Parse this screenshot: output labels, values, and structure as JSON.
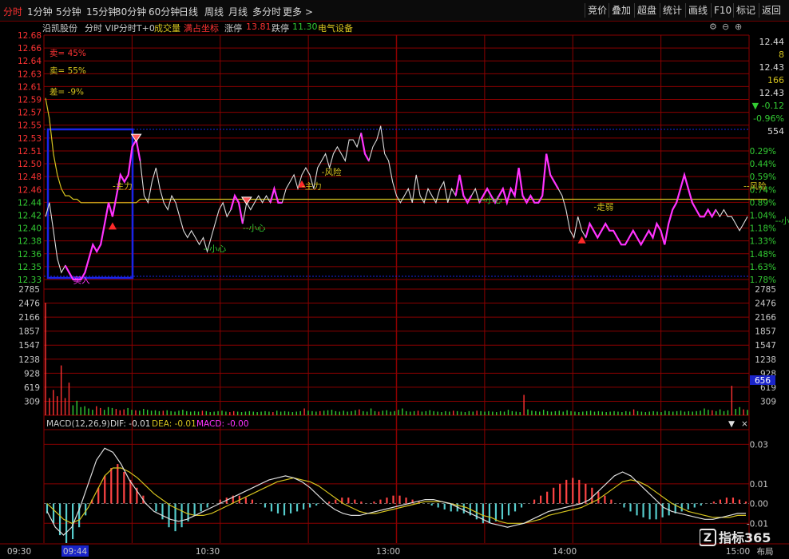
{
  "toolbar": {
    "tabs": [
      "分时",
      "1分钟",
      "5分钟",
      "15分钟",
      "30分钟",
      "60分钟",
      "日线",
      "周线",
      "月线",
      "多分时",
      "更多 >"
    ],
    "active_tab": "分时",
    "right_buttons": [
      "竞价",
      "叠加",
      "超盘",
      "统计",
      "画线",
      "F10",
      "标记",
      "返回"
    ]
  },
  "infobar": {
    "stock_name": "沿凯股份",
    "mode": "分时 VIP分时T+0",
    "volume_label": "成交量",
    "full_coord": "满占坐标",
    "limit_up_label": "涨停",
    "limit_up_value": "13.81",
    "limit_down_label": "跌停",
    "limit_down_value": "11.30",
    "sector": "电气设备"
  },
  "right_panel": {
    "price1": "12.44",
    "vol1": "8",
    "price2": "12.43",
    "vol2": "166",
    "price3": "12.43",
    "change": "▼ -0.12",
    "change_pct": "-0.96%",
    "vol3": "554",
    "vol_box": "656"
  },
  "colors": {
    "up": "#ff3333",
    "down": "#33cc33",
    "price_line": "#dddddd",
    "avg_line": "#d4c21e",
    "magenta": "#ff33ff",
    "box": "#1a24e8",
    "grid": "#8a0000",
    "macd_dea": "#d4c21e",
    "macd_dif": "#dddddd",
    "macd_up": "#ff4444",
    "macd_down": "#55cccc"
  },
  "chart_data": [
    {
      "type": "line",
      "panel": "price",
      "y_ticks_left": [
        "12.68",
        "12.66",
        "12.64",
        "12.63",
        "12.61",
        "12.59",
        "12.57",
        "12.55",
        "12.53",
        "12.51",
        "12.50",
        "12.48",
        "12.46",
        "12.44",
        "12.42",
        "12.40",
        "12.38",
        "12.36",
        "12.35",
        "12.33"
      ],
      "y_ticks_right": [
        "",
        "",
        "",
        "",
        "",
        "",
        "",
        "",
        "",
        "0.29%",
        "0.44%",
        "0.59%",
        "0.74%",
        "0.89%",
        "1.04%",
        "1.18%",
        "1.33%",
        "1.48%",
        "1.63%",
        "1.78%"
      ],
      "ylim": [
        12.33,
        12.68
      ],
      "x_labels": [
        "09:30",
        "09:44",
        "10:30",
        "13:00",
        "14:00",
        "15:00",
        "布局"
      ],
      "series": [
        {
          "values": [
            12.42,
            12.44,
            12.4,
            12.36,
            12.34,
            12.35,
            12.34,
            12.33,
            12.33,
            12.33,
            12.34,
            12.36,
            12.38,
            12.37,
            12.38,
            12.41,
            12.44,
            12.42,
            12.45,
            12.48,
            12.47,
            12.48,
            12.52,
            12.53,
            12.5,
            12.45,
            12.44,
            12.47,
            12.49,
            12.46,
            12.44,
            12.43,
            12.45,
            12.44,
            12.42,
            12.4,
            12.39,
            12.4,
            12.39,
            12.38,
            12.39,
            12.37,
            12.39,
            12.41,
            12.43,
            12.44,
            12.42,
            12.43,
            12.45,
            12.44,
            12.41,
            12.44,
            12.43,
            12.44,
            12.45,
            12.44,
            12.45,
            12.44,
            12.46,
            12.44,
            12.44,
            12.46,
            12.47,
            12.48,
            12.46,
            12.48,
            12.49,
            12.48,
            12.46,
            12.49,
            12.5,
            12.51,
            12.49,
            12.51,
            12.52,
            12.51,
            12.5,
            12.53,
            12.53,
            12.52,
            12.54,
            12.51,
            12.5,
            12.52,
            12.53,
            12.55,
            12.51,
            12.5,
            12.47,
            12.45,
            12.44,
            12.45,
            12.46,
            12.44,
            12.48,
            12.45,
            12.44,
            12.46,
            12.45,
            12.44,
            12.46,
            12.47,
            12.44,
            12.46,
            12.45,
            12.48,
            12.45,
            12.44,
            12.45,
            12.46,
            12.44,
            12.45,
            12.46,
            12.45,
            12.44,
            12.45,
            12.46,
            12.44,
            12.46,
            12.45,
            12.49,
            12.45,
            12.44,
            12.45,
            12.44,
            12.44,
            12.45,
            12.51,
            12.48,
            12.47,
            12.46,
            12.45,
            12.43,
            12.4,
            12.39,
            12.42,
            12.4,
            12.39,
            12.41,
            12.4,
            12.39,
            12.4,
            12.41,
            12.4,
            12.4,
            12.39,
            12.38,
            12.38,
            12.39,
            12.4,
            12.39,
            12.38,
            12.39,
            12.4,
            12.39,
            12.41,
            12.4,
            12.38,
            12.41,
            12.43,
            12.44,
            12.46,
            12.48,
            12.46,
            12.44,
            12.43,
            12.42,
            12.42,
            12.43,
            12.42,
            12.43,
            12.42,
            12.43,
            12.42,
            12.42,
            12.41,
            12.4,
            12.41,
            12.42
          ]
        },
        {
          "values": [
            12.59,
            12.56,
            12.51,
            12.48,
            12.46,
            12.45,
            12.45,
            12.445,
            12.445,
            12.44,
            12.44,
            12.44,
            12.44,
            12.44,
            12.44,
            12.44,
            12.44,
            12.44,
            12.44,
            12.44,
            12.44,
            12.44,
            12.44,
            12.44,
            12.445,
            12.445,
            12.445,
            12.445,
            12.445,
            12.445,
            12.445,
            12.445,
            12.445,
            12.445,
            12.445,
            12.445,
            12.445,
            12.445,
            12.445,
            12.445,
            12.445,
            12.445,
            12.445,
            12.445,
            12.445,
            12.445,
            12.445,
            12.445,
            12.445,
            12.445,
            12.445,
            12.445,
            12.445,
            12.445,
            12.445,
            12.445,
            12.445,
            12.445,
            12.445,
            12.445,
            12.445,
            12.445,
            12.445,
            12.445,
            12.445,
            12.445,
            12.445,
            12.445,
            12.445,
            12.445,
            12.445,
            12.445,
            12.445,
            12.445,
            12.445,
            12.445,
            12.445,
            12.445,
            12.445,
            12.445,
            12.445,
            12.445,
            12.445,
            12.445,
            12.445,
            12.445,
            12.445,
            12.445,
            12.445,
            12.445,
            12.445,
            12.445,
            12.445,
            12.445,
            12.445,
            12.445,
            12.445,
            12.445,
            12.445,
            12.445,
            12.445,
            12.445,
            12.445,
            12.445,
            12.445,
            12.445,
            12.445,
            12.445,
            12.445,
            12.445,
            12.445,
            12.445,
            12.445,
            12.445,
            12.445,
            12.445,
            12.445,
            12.445,
            12.445,
            12.445,
            12.445,
            12.445,
            12.445,
            12.445,
            12.445,
            12.445,
            12.445,
            12.445,
            12.445,
            12.445,
            12.445,
            12.445,
            12.445,
            12.445,
            12.445,
            12.445,
            12.445,
            12.445,
            12.445,
            12.445,
            12.445,
            12.445,
            12.445,
            12.445,
            12.445,
            12.445,
            12.445,
            12.445,
            12.445,
            12.445,
            12.445,
            12.445,
            12.445,
            12.445,
            12.445,
            12.445,
            12.445,
            12.445,
            12.445,
            12.445,
            12.445,
            12.445,
            12.445,
            12.445,
            12.445,
            12.445,
            12.445,
            12.445,
            12.445,
            12.445,
            12.445,
            12.445,
            12.445,
            12.445,
            12.445,
            12.445,
            12.445,
            12.445,
            12.445,
            12.445,
            12.445,
            12.445,
            12.445,
            12.445
          ]
        }
      ],
      "magenta_ranges": [
        [
          5,
          24
        ],
        [
          47,
          50
        ],
        [
          57,
          60
        ],
        [
          80,
          82
        ],
        [
          104,
          108
        ],
        [
          110,
          130
        ],
        [
          137,
          170
        ],
        [
          178,
          182
        ]
      ],
      "annotations": [
        {
          "text": "卖= 45%",
          "x": 1,
          "price": 12.65,
          "color": "#ff3333"
        },
        {
          "text": "卖= 55%",
          "x": 1,
          "price": 12.625,
          "color": "#d4c21e"
        },
        {
          "text": "差= -9%",
          "x": 1,
          "price": 12.595,
          "color": "#d4c21e"
        },
        {
          "text": "买入",
          "x": 7,
          "price": 12.325,
          "color": "#ff33ff"
        },
        {
          "text": "-主力",
          "x": 17,
          "price": 12.46,
          "color": "#d4c21e"
        },
        {
          "text": "--小心",
          "x": 40,
          "price": 12.37,
          "color": "#33cc33"
        },
        {
          "text": "--小心",
          "x": 50,
          "price": 12.4,
          "color": "#33cc33"
        },
        {
          "text": "-主力",
          "x": 65,
          "price": 12.46,
          "color": "#d4c21e"
        },
        {
          "text": "-风险",
          "x": 70,
          "price": 12.48,
          "color": "#d4c21e"
        },
        {
          "text": "--小心",
          "x": 110,
          "price": 12.44,
          "color": "#33cc33"
        },
        {
          "text": "-走弱",
          "x": 139,
          "price": 12.43,
          "color": "#d4c21e"
        },
        {
          "text": "--风险",
          "x": 177,
          "price": 12.46,
          "color": "#d4c21e"
        },
        {
          "text": "--小心",
          "x": 185,
          "price": 12.41,
          "color": "#33cc33"
        }
      ],
      "signals_up": [
        17,
        65,
        136
      ],
      "signals_down": [
        23,
        51
      ]
    },
    {
      "type": "bar",
      "panel": "volume",
      "y_ticks": [
        "2785",
        "2476",
        "2166",
        "1857",
        "1547",
        "1238",
        "928",
        "619",
        "309"
      ],
      "ylim": [
        0,
        2785
      ],
      "values": [
        2480,
        380,
        560,
        420,
        1100,
        380,
        720,
        220,
        320,
        180,
        200,
        150,
        120,
        200,
        160,
        120,
        180,
        160,
        140,
        110,
        130,
        160,
        120,
        110,
        100,
        140,
        120,
        100,
        110,
        90,
        100,
        110,
        90,
        80,
        100,
        120,
        90,
        80,
        90,
        80,
        100,
        90,
        70,
        80,
        90,
        100,
        80,
        70,
        90,
        80,
        70,
        80,
        90,
        80,
        70,
        80,
        90,
        80,
        70,
        100,
        80,
        90,
        80,
        70,
        80,
        90,
        150,
        100,
        90,
        80,
        90,
        100,
        110,
        120,
        90,
        80,
        100,
        80,
        90,
        110,
        130,
        90,
        80,
        150,
        90,
        80,
        100,
        110,
        80,
        90,
        120,
        150,
        90,
        80,
        90,
        100,
        80,
        90,
        110,
        90,
        80,
        70,
        90,
        80,
        100,
        90,
        80,
        70,
        90,
        80,
        100,
        90,
        80,
        90,
        80,
        70,
        90,
        80,
        120,
        90,
        80,
        70,
        450,
        130,
        100,
        90,
        80,
        120,
        90,
        80,
        90,
        100,
        80,
        110,
        90,
        80,
        70,
        80,
        90,
        100,
        80,
        90,
        80,
        70,
        80,
        90,
        80,
        70,
        90,
        80,
        130,
        90,
        80,
        70,
        80,
        90,
        80,
        70,
        100,
        90,
        80,
        90,
        100,
        80,
        90,
        80,
        90,
        100,
        150,
        120,
        110,
        90,
        130,
        90,
        110,
        650,
        140,
        180,
        130,
        120
      ],
      "colors_up": [
        0,
        1,
        2,
        3,
        4,
        5,
        6,
        13,
        14,
        18,
        19,
        20,
        23,
        30,
        40,
        47,
        48,
        58,
        66,
        70,
        80,
        85,
        95,
        104,
        110,
        122,
        150,
        170,
        175,
        178,
        180,
        183
      ]
    },
    {
      "type": "bar",
      "panel": "macd",
      "title": "MACD(12,26,9)",
      "dif_label": "DIF: -0.01",
      "dea_label": "DEA: -0.01",
      "macd_label": "MACD: -0.00",
      "y_ticks": [
        "0.03",
        "0.01",
        "0.00",
        "-0.01"
      ],
      "ylim": [
        -0.02,
        0.035
      ],
      "values": [
        -0.005,
        -0.01,
        -0.016,
        -0.02,
        -0.018,
        -0.012,
        -0.006,
        0.002,
        0.008,
        0.014,
        0.018,
        0.02,
        0.016,
        0.012,
        0.008,
        0.004,
        0.0,
        -0.004,
        -0.008,
        -0.012,
        -0.014,
        -0.012,
        -0.009,
        -0.006,
        -0.004,
        -0.002,
        0.0,
        0.002,
        0.003,
        0.004,
        0.004,
        0.003,
        0.002,
        0.0,
        -0.002,
        -0.004,
        -0.005,
        -0.006,
        -0.005,
        -0.004,
        -0.003,
        -0.002,
        -0.001,
        0.0,
        0.001,
        0.002,
        0.003,
        0.003,
        0.002,
        0.001,
        0.0,
        0.001,
        0.002,
        0.003,
        0.004,
        0.004,
        0.003,
        0.002,
        0.001,
        0.0,
        -0.001,
        -0.002,
        -0.003,
        -0.004,
        -0.004,
        -0.005,
        -0.006,
        -0.008,
        -0.01,
        -0.01,
        -0.009,
        -0.008,
        -0.006,
        -0.004,
        -0.002,
        0.0,
        0.002,
        0.004,
        0.006,
        0.008,
        0.01,
        0.012,
        0.013,
        0.012,
        0.01,
        0.008,
        0.006,
        0.004,
        0.002,
        0.0,
        -0.002,
        -0.004,
        -0.006,
        -0.007,
        -0.008,
        -0.008,
        -0.007,
        -0.006,
        -0.005,
        -0.004,
        -0.003,
        -0.002,
        -0.001,
        0.0,
        0.001,
        0.002,
        0.003,
        0.003,
        0.002,
        0.001
      ],
      "dif": [
        -0.004,
        -0.012,
        -0.016,
        -0.012,
        -0.002,
        0.01,
        0.022,
        0.028,
        0.026,
        0.02,
        0.012,
        0.006,
        0.0,
        -0.004,
        -0.006,
        -0.008,
        -0.009,
        -0.008,
        -0.006,
        -0.004,
        -0.002,
        0.0,
        0.002,
        0.004,
        0.006,
        0.008,
        0.01,
        0.012,
        0.013,
        0.014,
        0.013,
        0.011,
        0.008,
        0.004,
        0.0,
        -0.003,
        -0.005,
        -0.006,
        -0.006,
        -0.005,
        -0.004,
        -0.003,
        -0.002,
        -0.001,
        0.0,
        0.001,
        0.002,
        0.002,
        0.001,
        0.0,
        -0.002,
        -0.004,
        -0.006,
        -0.008,
        -0.01,
        -0.011,
        -0.012,
        -0.011,
        -0.01,
        -0.008,
        -0.006,
        -0.004,
        -0.003,
        -0.002,
        -0.001,
        0.0,
        0.002,
        0.006,
        0.01,
        0.014,
        0.016,
        0.014,
        0.01,
        0.006,
        0.002,
        -0.002,
        -0.004,
        -0.005,
        -0.006,
        -0.007,
        -0.008,
        -0.008,
        -0.007,
        -0.006,
        -0.005,
        -0.005
      ],
      "dea": [
        0.0,
        -0.004,
        -0.008,
        -0.01,
        -0.008,
        -0.002,
        0.006,
        0.014,
        0.018,
        0.018,
        0.016,
        0.013,
        0.009,
        0.005,
        0.002,
        -0.001,
        -0.003,
        -0.005,
        -0.006,
        -0.006,
        -0.005,
        -0.003,
        -0.001,
        0.001,
        0.003,
        0.005,
        0.007,
        0.009,
        0.011,
        0.012,
        0.013,
        0.012,
        0.011,
        0.009,
        0.006,
        0.003,
        0.0,
        -0.002,
        -0.004,
        -0.005,
        -0.005,
        -0.004,
        -0.003,
        -0.002,
        -0.001,
        0.0,
        0.001,
        0.001,
        0.001,
        0.0,
        -0.001,
        -0.002,
        -0.004,
        -0.006,
        -0.007,
        -0.009,
        -0.01,
        -0.01,
        -0.01,
        -0.009,
        -0.008,
        -0.006,
        -0.005,
        -0.004,
        -0.003,
        -0.002,
        0.0,
        0.002,
        0.005,
        0.008,
        0.011,
        0.012,
        0.011,
        0.009,
        0.006,
        0.003,
        0.0,
        -0.002,
        -0.004,
        -0.005,
        -0.006,
        -0.007,
        -0.007,
        -0.007,
        -0.006,
        -0.006
      ]
    }
  ]
}
